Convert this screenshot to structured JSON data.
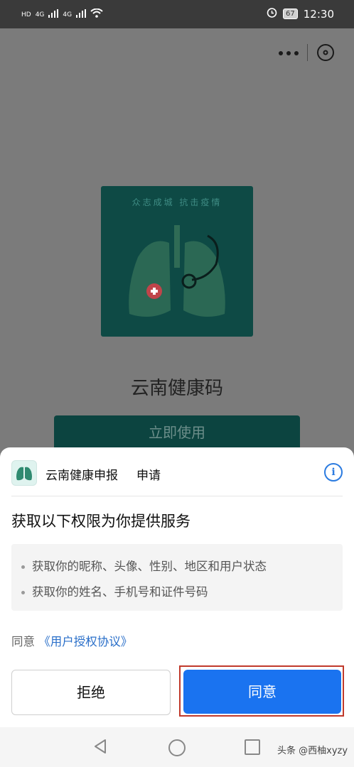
{
  "status_bar": {
    "left_indicators": [
      "HD",
      "4G",
      "4G"
    ],
    "battery": "67",
    "time": "12:30"
  },
  "page": {
    "hero_slogan": "众志成城 抗击疫情",
    "app_title": "云南健康码",
    "use_button": "立即使用"
  },
  "sheet": {
    "app_name": "云南健康申报",
    "request_label": "申请",
    "title": "获取以下权限为你提供服务",
    "permissions": [
      "获取你的昵称、头像、性别、地区和用户状态",
      "获取你的姓名、手机号和证件号码"
    ],
    "agree_prefix": "同意",
    "agree_link": "《用户授权协议》",
    "reject_button": "拒绝",
    "agree_button": "同意"
  },
  "watermark": "头条 @西柚xyzy",
  "colors": {
    "accent": "#1a73f0",
    "hero_bg": "#0e4a45",
    "highlight_frame": "#c0392b"
  }
}
